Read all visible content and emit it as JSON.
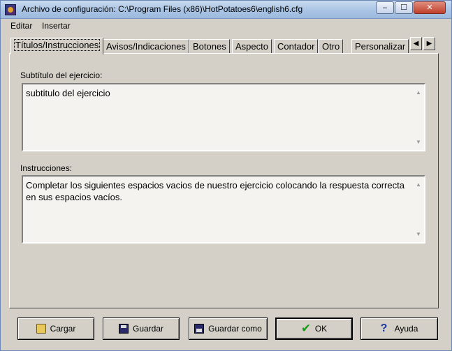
{
  "window": {
    "title": "Archivo de configuración: C:\\Program Files (x86)\\HotPotatoes6\\english6.cfg",
    "minimize": "‒",
    "maximize": "☐",
    "close": "✕"
  },
  "menu": {
    "items": [
      "Editar",
      "Insertar"
    ]
  },
  "tabs": [
    "Títulos/Instrucciones",
    "Avisos/Indicaciones",
    "Botones",
    "Aspecto",
    "Contador",
    "Otro",
    "Personalizar"
  ],
  "tab_scroll": {
    "left": "◀",
    "right": "▶"
  },
  "fields": {
    "subtitle_label": "Subtítulo del ejercicio:",
    "subtitle_value": "subtitulo del ejercicio",
    "instructions_label": "Instrucciones:",
    "instructions_value": "Completar los siguientes espacios vacios de nuestro ejercicio colocando la respuesta correcta en sus espacios vacíos."
  },
  "buttons": {
    "load": "Cargar",
    "save": "Guardar",
    "save_as": "Guardar como",
    "ok": "OK",
    "help": "Ayuda"
  }
}
